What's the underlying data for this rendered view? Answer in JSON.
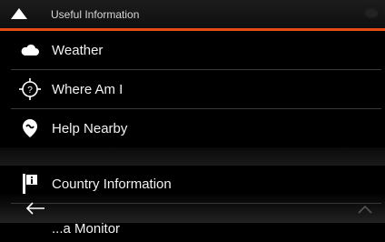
{
  "header": {
    "title": "Useful Information",
    "back_icon": "up-triangle-icon"
  },
  "colors": {
    "accent": "#e64a19",
    "background": "#000000"
  },
  "items": [
    {
      "label": "Weather",
      "icon": "cloud-icon"
    },
    {
      "label": "Where Am I",
      "icon": "question-location-icon"
    },
    {
      "label": "Help Nearby",
      "icon": "help-pin-icon"
    },
    {
      "label": "Country Information",
      "icon": "info-icon"
    },
    {
      "label": "...a Monitor",
      "icon": ""
    }
  ],
  "bottom": {
    "back_icon": "arrow-left-icon",
    "right_icon": "chevron-up-icon"
  }
}
